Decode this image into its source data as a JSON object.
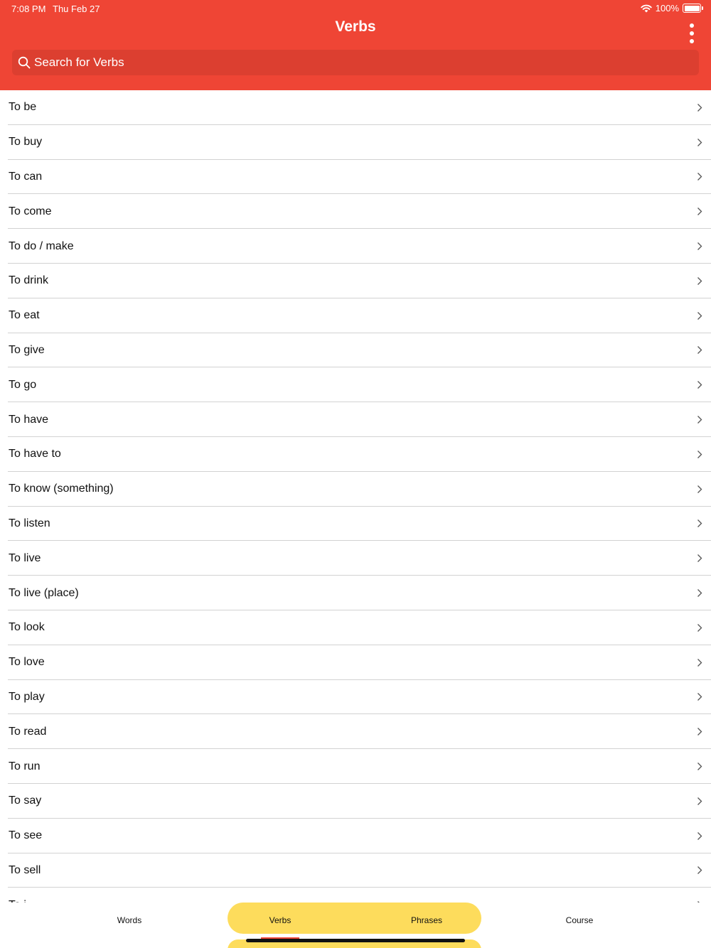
{
  "status_bar": {
    "time": "7:08 PM",
    "date": "Thu Feb 27",
    "battery": "100%",
    "battery_level": 1.0
  },
  "header": {
    "title": "Verbs",
    "more_icon": "more-vertical-icon"
  },
  "search": {
    "placeholder": "Search for Verbs",
    "icon": "search-icon"
  },
  "verbs": [
    "To be",
    "To buy",
    "To can",
    "To come",
    "To do / make",
    "To drink",
    "To eat",
    "To give",
    "To go",
    "To have",
    "To have to",
    "To know (something)",
    "To listen",
    "To live",
    "To live (place)",
    "To look",
    "To love",
    "To play",
    "To read",
    "To run",
    "To say",
    "To see",
    "To sell",
    "To j..."
  ],
  "tabs": [
    {
      "label": "Words",
      "active": false
    },
    {
      "label": "Verbs",
      "active": true
    },
    {
      "label": "Phrases",
      "active": false
    },
    {
      "label": "Course",
      "active": false
    }
  ],
  "colors": {
    "accent": "#EF4535",
    "tab_highlight": "#FDDC5C",
    "text": "#111111",
    "divider": "#D2D2D2"
  }
}
